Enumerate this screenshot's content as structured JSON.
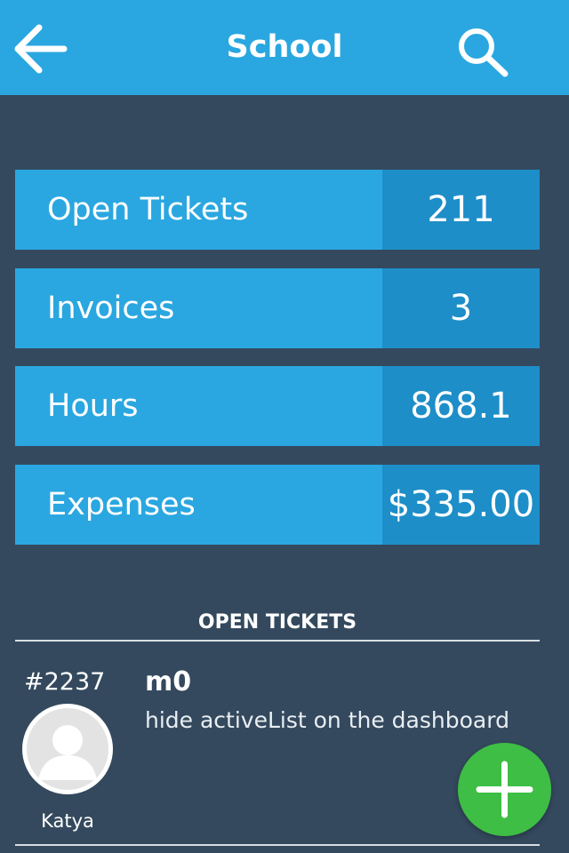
{
  "header": {
    "title": "School",
    "back_icon": "arrow-left-icon",
    "search_icon": "search-icon"
  },
  "stats": [
    {
      "label": "Open Tickets",
      "value": "211"
    },
    {
      "label": "Invoices",
      "value": "3"
    },
    {
      "label": "Hours",
      "value": "868.1"
    },
    {
      "label": "Expenses",
      "value": "$335.00"
    }
  ],
  "open_tickets": {
    "heading": "OPEN TICKETS",
    "items": [
      {
        "id": "#2237",
        "title": "m0",
        "description": "hide activeList on the dashboard",
        "user": "Katya",
        "avatar_icon": "user-avatar-icon"
      }
    ]
  },
  "fab": {
    "icon": "plus-icon"
  },
  "colors": {
    "header": "#2aa7e0",
    "background": "#34495e",
    "stat_label_bg": "#2aa7e0",
    "stat_value_bg": "#1d8ec8",
    "fab": "#3ebe44"
  }
}
